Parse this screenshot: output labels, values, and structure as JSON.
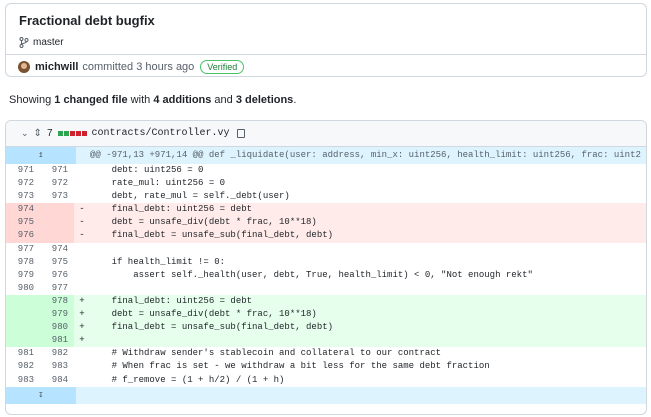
{
  "commit": {
    "title": "Fractional debt bugfix",
    "branch": "master",
    "author": "michwill",
    "meta": "committed 3 hours ago",
    "verified": "Verified"
  },
  "summary": {
    "prefix": "Showing ",
    "files": "1 changed file",
    "mid": " with ",
    "additions": "4 additions",
    "and": " and ",
    "deletions": "3 deletions",
    "suffix": "."
  },
  "file": {
    "changes": "7",
    "name": "contracts/Controller.vy",
    "hunk": "@@ -971,13 +971,14 @@ def _liquidate(user: address, min_x: uint256, health_limit: uint256, frac: uint2",
    "lines": [
      {
        "type": "ctx",
        "old": "971",
        "new": "971",
        "sign": "",
        "code": "    debt: uint256 = 0"
      },
      {
        "type": "ctx",
        "old": "972",
        "new": "972",
        "sign": "",
        "code": "    rate_mul: uint256 = 0"
      },
      {
        "type": "ctx",
        "old": "973",
        "new": "973",
        "sign": "",
        "code": "    debt, rate_mul = self._debt(user)"
      },
      {
        "type": "del",
        "old": "974",
        "new": "",
        "sign": "-",
        "code": "    final_debt: uint256 = debt"
      },
      {
        "type": "del",
        "old": "975",
        "new": "",
        "sign": "-",
        "code": "    debt = unsafe_div(debt * frac, 10**18)"
      },
      {
        "type": "del",
        "old": "976",
        "new": "",
        "sign": "-",
        "code": "    final_debt = unsafe_sub(final_debt, debt)"
      },
      {
        "type": "ctx",
        "old": "977",
        "new": "974",
        "sign": "",
        "code": ""
      },
      {
        "type": "ctx",
        "old": "978",
        "new": "975",
        "sign": "",
        "code": "    if health_limit != 0:"
      },
      {
        "type": "ctx",
        "old": "979",
        "new": "976",
        "sign": "",
        "code": "        assert self._health(user, debt, True, health_limit) < 0, \"Not enough rekt\""
      },
      {
        "type": "ctx",
        "old": "980",
        "new": "977",
        "sign": "",
        "code": ""
      },
      {
        "type": "add",
        "old": "",
        "new": "978",
        "sign": "+",
        "code": "    final_debt: uint256 = debt"
      },
      {
        "type": "add",
        "old": "",
        "new": "979",
        "sign": "+",
        "code": "    debt = unsafe_div(debt * frac, 10**18)"
      },
      {
        "type": "add",
        "old": "",
        "new": "980",
        "sign": "+",
        "code": "    final_debt = unsafe_sub(final_debt, debt)"
      },
      {
        "type": "add",
        "old": "",
        "new": "981",
        "sign": "+",
        "code": ""
      },
      {
        "type": "ctx",
        "old": "981",
        "new": "982",
        "sign": "",
        "code": "    # Withdraw sender's stablecoin and collateral to our contract"
      },
      {
        "type": "ctx",
        "old": "982",
        "new": "983",
        "sign": "",
        "code": "    # When frac is set - we withdraw a bit less for the same debt fraction"
      },
      {
        "type": "ctx",
        "old": "983",
        "new": "984",
        "sign": "",
        "code": "    # f_remove = (1 + h/2) / (1 + h)"
      }
    ]
  },
  "colors": {
    "add_bg": "#e6ffec",
    "del_bg": "#ffebe9",
    "hunk_bg": "#ddf4ff"
  }
}
